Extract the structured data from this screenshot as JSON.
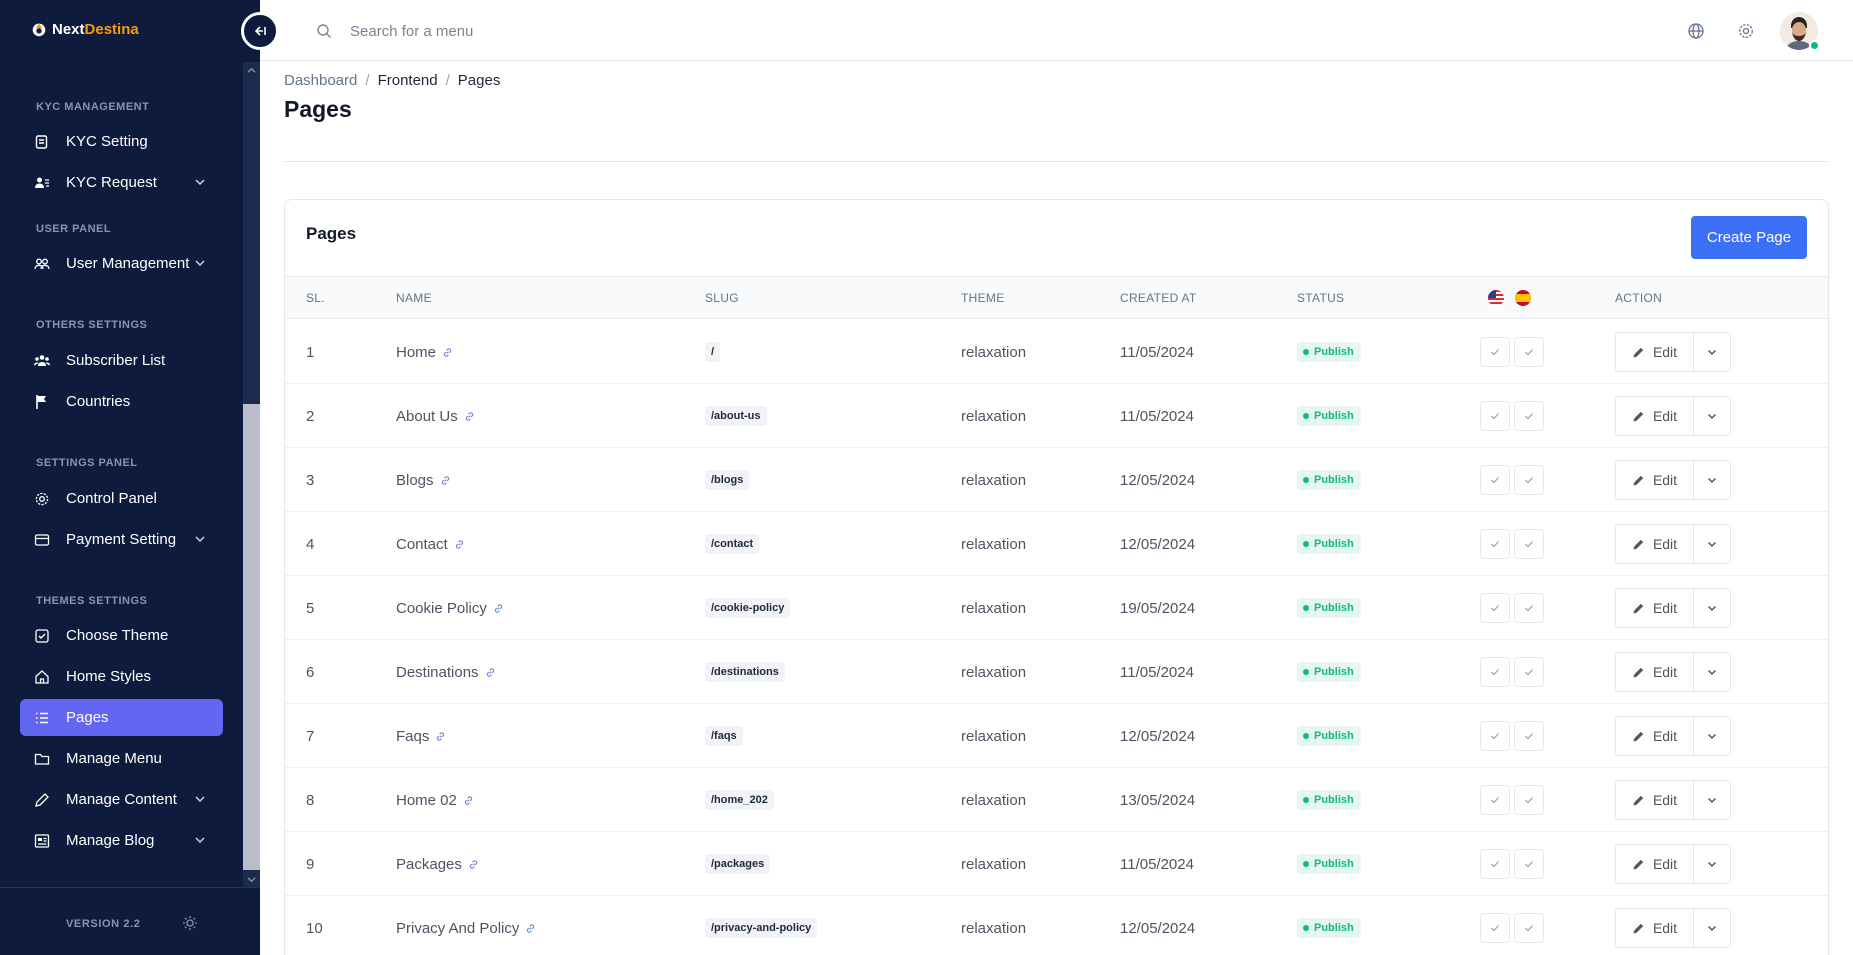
{
  "brand": {
    "name_part1": "Next",
    "name_part2": "Destina"
  },
  "search": {
    "placeholder": "Search for a menu"
  },
  "sidebar": {
    "sections": [
      {
        "title": "KYC MANAGEMENT",
        "items": [
          {
            "label": "KYC Setting",
            "icon": "document-icon",
            "has_children": false
          },
          {
            "label": "KYC Request",
            "icon": "users-icon",
            "has_children": true
          }
        ]
      },
      {
        "title": "USER PANEL",
        "items": [
          {
            "label": "User Management",
            "icon": "user-group-icon",
            "has_children": true
          }
        ]
      },
      {
        "title": "OTHERS SETTINGS",
        "items": [
          {
            "label": "Subscriber List",
            "icon": "people-icon",
            "has_children": false
          },
          {
            "label": "Countries",
            "icon": "flag-icon",
            "has_children": false
          }
        ]
      },
      {
        "title": "SETTINGS PANEL",
        "items": [
          {
            "label": "Control Panel",
            "icon": "gear-icon",
            "has_children": false
          },
          {
            "label": "Payment Setting",
            "icon": "card-icon",
            "has_children": true
          }
        ]
      },
      {
        "title": "THEMES SETTINGS",
        "items": [
          {
            "label": "Choose Theme",
            "icon": "checkbox-icon",
            "has_children": false
          },
          {
            "label": "Home Styles",
            "icon": "home-icon",
            "has_children": false
          },
          {
            "label": "Pages",
            "icon": "list-icon",
            "has_children": false,
            "active": true
          },
          {
            "label": "Manage Menu",
            "icon": "folder-icon",
            "has_children": false
          },
          {
            "label": "Manage Content",
            "icon": "pencil-icon",
            "has_children": true
          },
          {
            "label": "Manage Blog",
            "icon": "newspaper-icon",
            "has_children": true
          }
        ]
      }
    ],
    "version": "VERSION 2.2"
  },
  "breadcrumb": [
    "Dashboard",
    "Frontend",
    "Pages"
  ],
  "page_title": "Pages",
  "card": {
    "title": "Pages",
    "create_button": "Create Page",
    "columns": [
      "SL.",
      "NAME",
      "SLUG",
      "THEME",
      "CREATED AT",
      "STATUS",
      "ACTION"
    ],
    "languages": [
      "en-us-flag",
      "es-flag"
    ],
    "edit_label": "Edit",
    "rows": [
      {
        "sl": "1",
        "name": "Home",
        "slug": "/",
        "theme": "relaxation",
        "created": "11/05/2024",
        "status": "Publish"
      },
      {
        "sl": "2",
        "name": "About Us",
        "slug": "/about-us",
        "theme": "relaxation",
        "created": "11/05/2024",
        "status": "Publish"
      },
      {
        "sl": "3",
        "name": "Blogs",
        "slug": "/blogs",
        "theme": "relaxation",
        "created": "12/05/2024",
        "status": "Publish"
      },
      {
        "sl": "4",
        "name": "Contact",
        "slug": "/contact",
        "theme": "relaxation",
        "created": "12/05/2024",
        "status": "Publish"
      },
      {
        "sl": "5",
        "name": "Cookie Policy",
        "slug": "/cookie-policy",
        "theme": "relaxation",
        "created": "19/05/2024",
        "status": "Publish"
      },
      {
        "sl": "6",
        "name": "Destinations",
        "slug": "/destinations",
        "theme": "relaxation",
        "created": "11/05/2024",
        "status": "Publish"
      },
      {
        "sl": "7",
        "name": "Faqs",
        "slug": "/faqs",
        "theme": "relaxation",
        "created": "12/05/2024",
        "status": "Publish"
      },
      {
        "sl": "8",
        "name": "Home 02",
        "slug": "/home_202",
        "theme": "relaxation",
        "created": "13/05/2024",
        "status": "Publish"
      },
      {
        "sl": "9",
        "name": "Packages",
        "slug": "/packages",
        "theme": "relaxation",
        "created": "11/05/2024",
        "status": "Publish"
      },
      {
        "sl": "10",
        "name": "Privacy And Policy",
        "slug": "/privacy-and-policy",
        "theme": "relaxation",
        "created": "12/05/2024",
        "status": "Publish"
      }
    ]
  },
  "colors": {
    "sidebar_bg": "#0e1b3d",
    "active_item": "#6366f1",
    "primary": "#3b6ff5",
    "publish": "#10b981",
    "brand_accent": "#f59e0b"
  }
}
